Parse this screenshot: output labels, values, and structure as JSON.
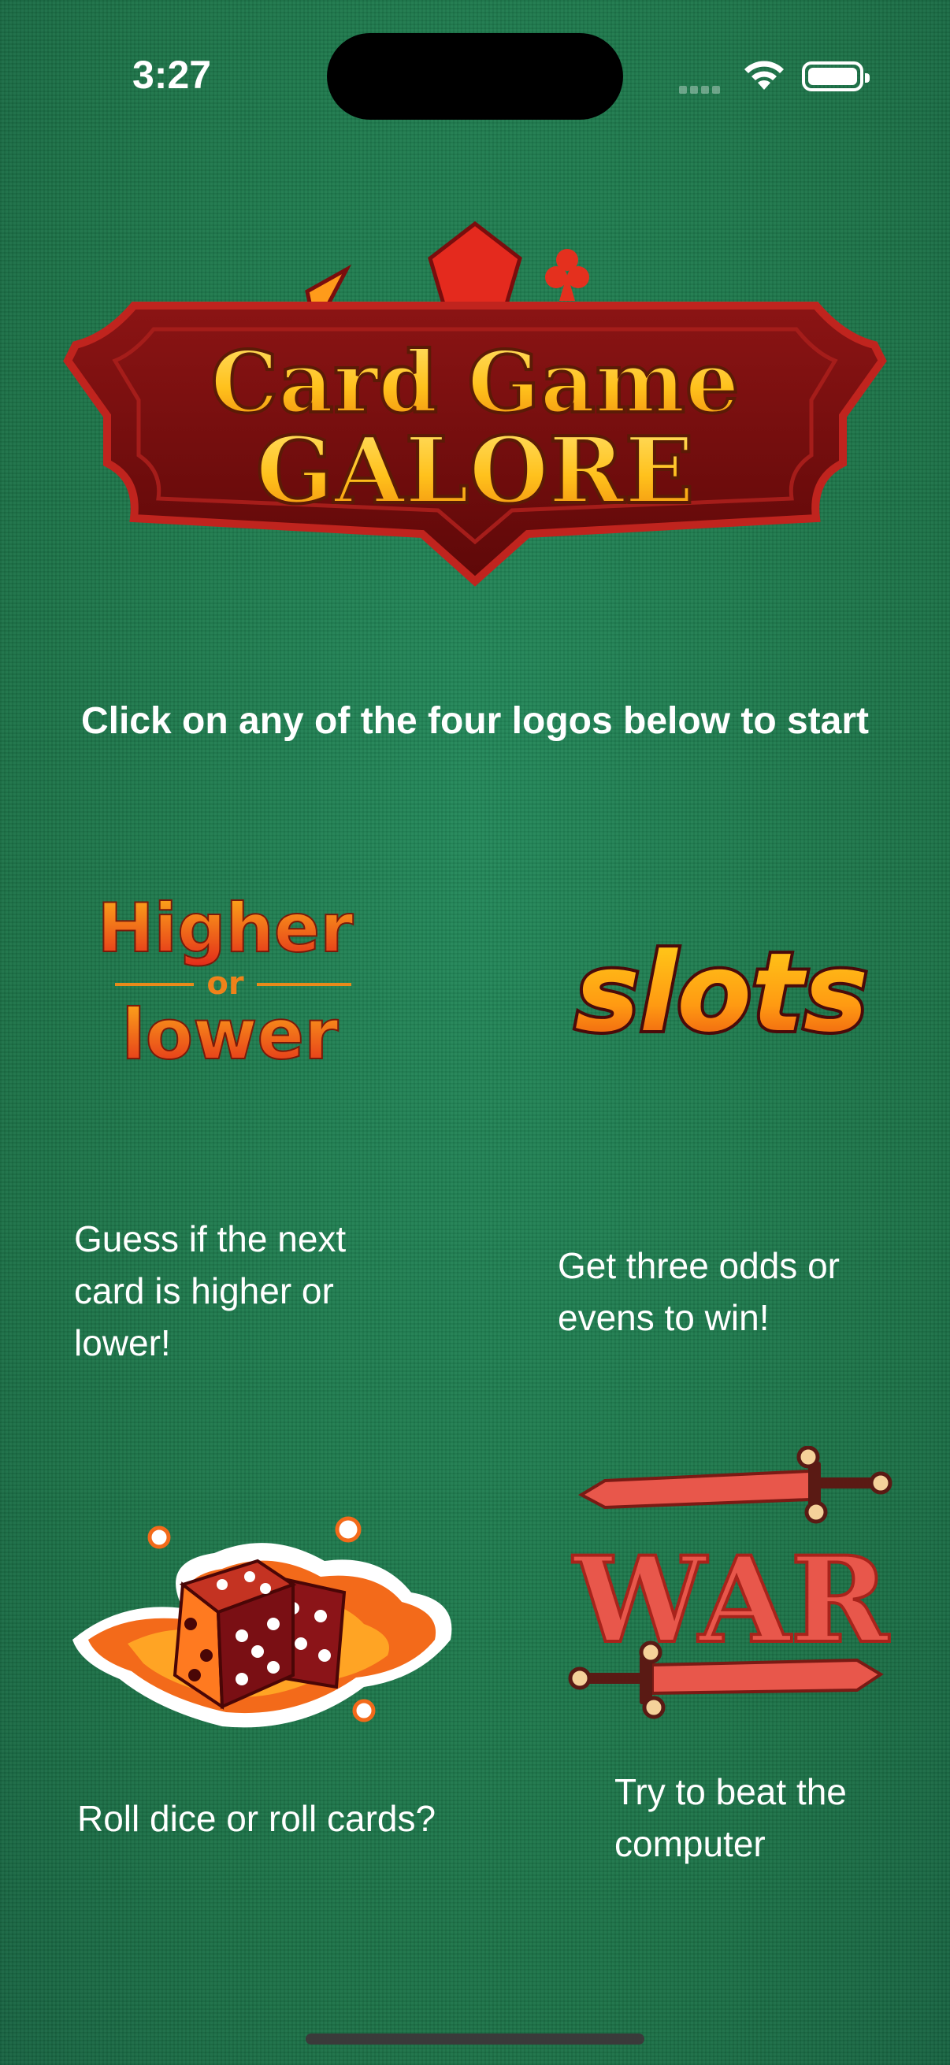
{
  "status_bar": {
    "time": "3:27"
  },
  "header": {
    "logo_line1": "Card Game",
    "logo_line2": "GALORE",
    "instruction": "Click on any of the four logos below to start"
  },
  "games": [
    {
      "logo_line1": "Higher",
      "logo_mid": "or",
      "logo_line2": "lower",
      "description": "Guess if the next card is higher or lower!"
    },
    {
      "logo_text": "slots",
      "description": "Get three odds or evens to win!"
    },
    {
      "logo_text": "",
      "description": "Roll dice or roll cards?"
    },
    {
      "logo_text": "WAR",
      "description": "Try to beat the computer"
    }
  ],
  "colors": {
    "background": "#1f7a4c",
    "logo_plaque": "#7a0d0d",
    "gold": "#ffc21a",
    "orange": "#f26a1b",
    "war_red": "#e8574b"
  }
}
